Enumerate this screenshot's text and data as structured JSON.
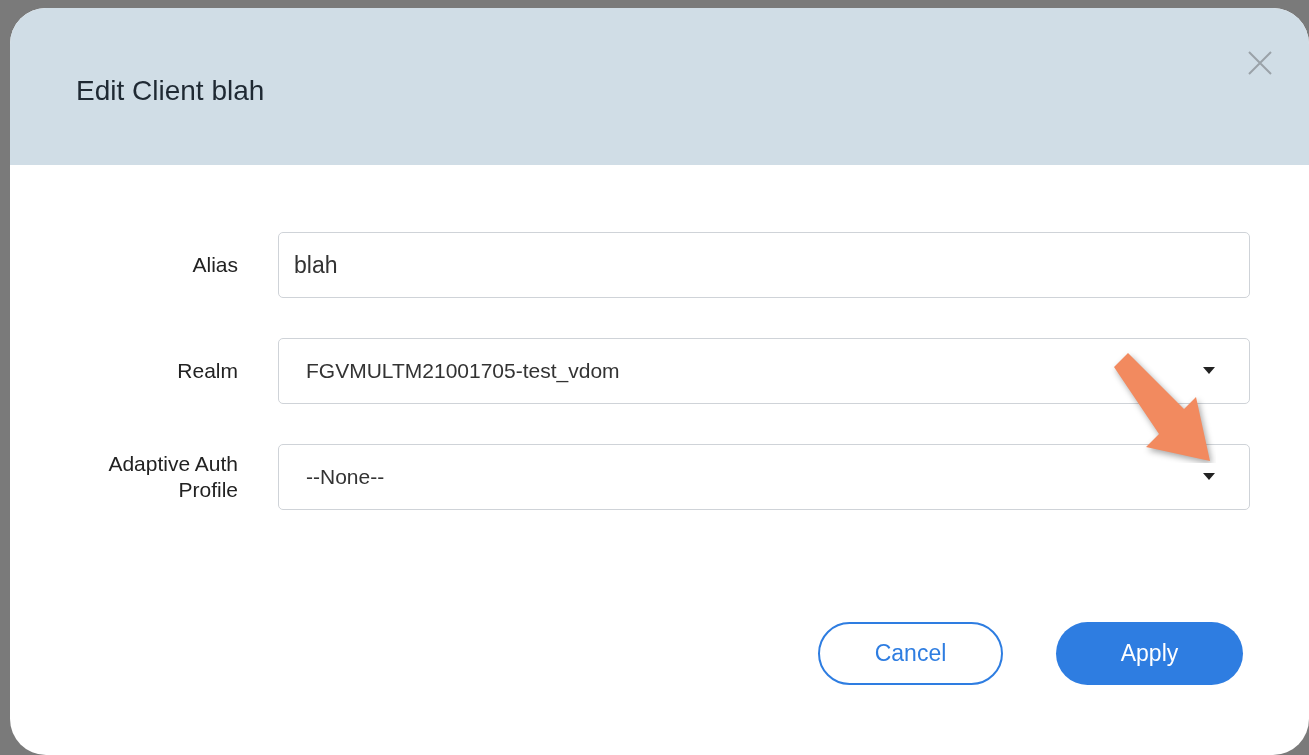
{
  "dialog": {
    "title": "Edit Client blah"
  },
  "fields": [
    {
      "label": "Alias",
      "kind": "input",
      "value": "blah"
    },
    {
      "label": "Realm",
      "kind": "select",
      "value": "FGVMULTM21001705-test_vdom"
    },
    {
      "label": "Adaptive Auth Profile",
      "kind": "select",
      "value": "--None--"
    }
  ],
  "buttons": [
    {
      "label": "Cancel",
      "kind": "secondary"
    },
    {
      "label": "Apply",
      "kind": "primary"
    }
  ]
}
